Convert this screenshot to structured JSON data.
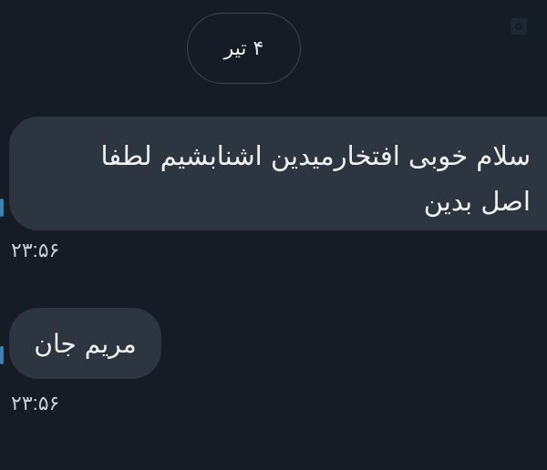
{
  "chat": {
    "date_divider": "۴ تیر",
    "messages": [
      {
        "text": "سلام خوبی افتخارمیدین اشنابشیم لطفا اصل بدین",
        "time": "۲۳:۵۶"
      },
      {
        "text": "مریم جان",
        "time": "۲۳:۵۶"
      }
    ]
  },
  "colors": {
    "background": "#151c26",
    "bubble": "#2d3640",
    "divider_border": "#3b4653",
    "timestamp": "#c7ced6"
  },
  "icons": {
    "corner": "status-icon"
  }
}
